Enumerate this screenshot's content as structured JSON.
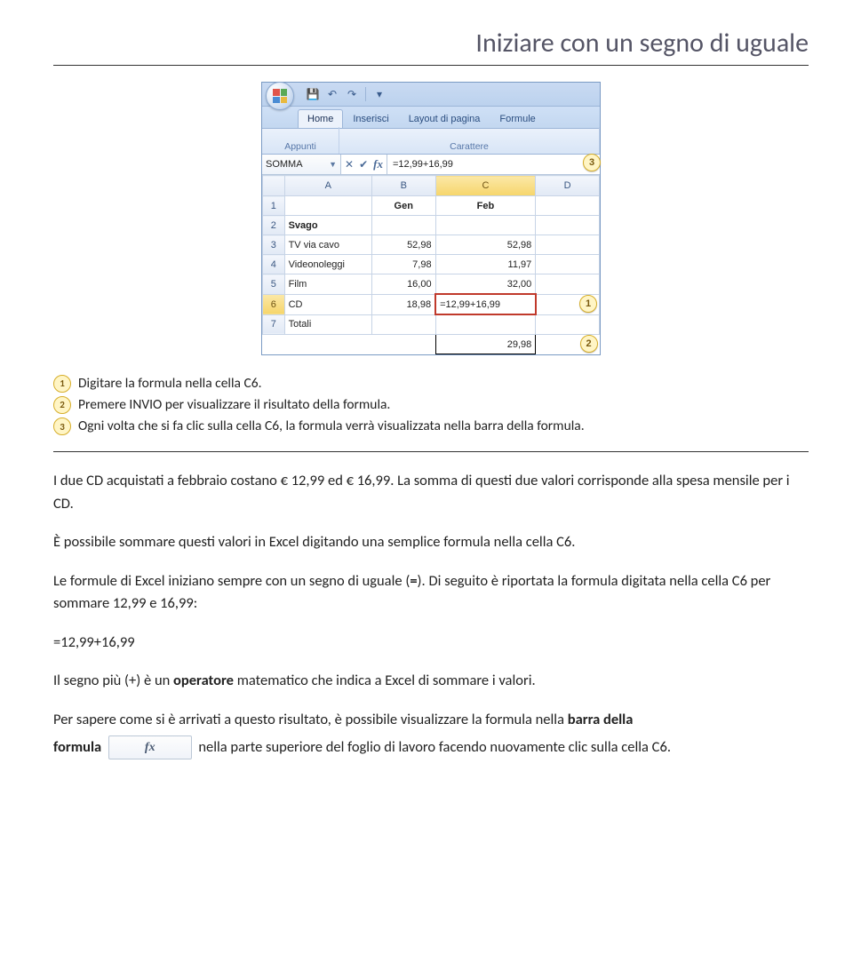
{
  "title": "Iniziare con un segno di uguale",
  "excel": {
    "tabs": [
      "Home",
      "Inserisci",
      "Layout di pagina",
      "Formule"
    ],
    "ribbon_groups": [
      "Appunti",
      "Carattere"
    ],
    "namebox": "SOMMA",
    "formula_bar": "=12,99+16,99",
    "columns": [
      "A",
      "B",
      "C",
      "D"
    ],
    "rows": [
      {
        "n": "1",
        "a": "",
        "b": "Gen",
        "c": "Feb",
        "d": ""
      },
      {
        "n": "2",
        "a": "Svago",
        "b": "",
        "c": "",
        "d": ""
      },
      {
        "n": "3",
        "a": "TV via cavo",
        "b": "52,98",
        "c": "52,98",
        "d": ""
      },
      {
        "n": "4",
        "a": "Videonoleggi",
        "b": "7,98",
        "c": "11,97",
        "d": ""
      },
      {
        "n": "5",
        "a": "Film",
        "b": "16,00",
        "c": "32,00",
        "d": ""
      },
      {
        "n": "6",
        "a": "CD",
        "b": "18,98",
        "c": "=12,99+16,99",
        "d": ""
      },
      {
        "n": "7",
        "a": "Totali",
        "b": "",
        "c": "",
        "d": ""
      }
    ],
    "result_value": "29,98",
    "callouts": {
      "c1": "1",
      "c2": "2",
      "c3": "3"
    }
  },
  "captions": {
    "c1": "Digitare la formula nella cella C6.",
    "c2": "Premere INVIO per visualizzare il risultato della formula.",
    "c3": "Ogni volta che si fa clic sulla cella C6, la formula verrà visualizzata nella barra della formula."
  },
  "body": {
    "p1": "I due CD acquistati a febbraio costano € 12,99 ed € 16,99. La somma di questi due valori corrisponde alla spesa mensile per i CD.",
    "p2": "È possibile sommare questi valori in Excel digitando una semplice formula nella cella C6.",
    "p3a": "Le formule di Excel iniziano sempre con un segno di uguale (",
    "p3sign": "=",
    "p3b": "). Di seguito è riportata la formula digitata nella cella C6 per sommare 12,99 e 16,99:",
    "formula_line": "=12,99+16,99",
    "p4a": "Il segno più (+) è un ",
    "p4b": "operatore",
    "p4c": " matematico che indica a Excel di sommare i valori.",
    "p5a": "Per sapere come si è arrivati a questo risultato, è possibile visualizzare la formula nella ",
    "p5b": "barra della",
    "p6a": "formula",
    "fx_label": "fx",
    "p6b": " nella parte superiore del foglio di lavoro facendo nuovamente clic sulla cella C6."
  }
}
